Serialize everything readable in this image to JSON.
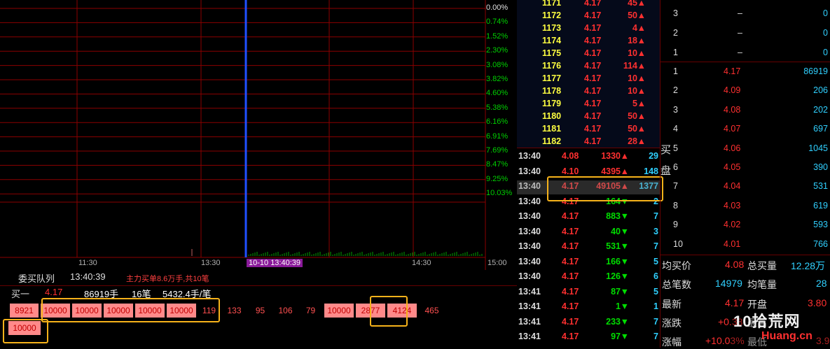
{
  "colors": {
    "up": "#ff3030",
    "down": "#00dd00",
    "grid": "#8b0000",
    "cyan": "#30d0ff",
    "highlight": "#f6b21a"
  },
  "chart": {
    "time_labels": [
      "11:30",
      "13:30",
      "15:00"
    ],
    "cursor_label": "10-10 13:40:39",
    "pct_labels": [
      "0.00%",
      "0.74%",
      "1.52%",
      "2.30%",
      "3.08%",
      "3.82%",
      "4.60%",
      "5.38%",
      "6.16%",
      "6.91%",
      "7.69%",
      "8.47%",
      "9.25%",
      "10.03%"
    ],
    "extra_time": "14:30"
  },
  "queue": {
    "title": "委买队列",
    "time": "13:40:39",
    "summary": "主力买单8.6万手,共10笔",
    "buy1_label": "买一",
    "buy1_price": "4.17",
    "buy1_volume": "86919手",
    "buy1_count": "16笔",
    "buy1_avg": "5432.4手/笔",
    "row1": [
      "8921",
      "10000",
      "10000",
      "10000",
      "10000",
      "10000",
      "119",
      "133",
      "95",
      "106",
      "79",
      "10000",
      "2877",
      "4124",
      "465"
    ],
    "row2": [
      "10000"
    ]
  },
  "ticks_top": [
    {
      "id": "1171",
      "price": "4.17",
      "vol": "45"
    },
    {
      "id": "1172",
      "price": "4.17",
      "vol": "50"
    },
    {
      "id": "1173",
      "price": "4.17",
      "vol": "4"
    },
    {
      "id": "1174",
      "price": "4.17",
      "vol": "18"
    },
    {
      "id": "1175",
      "price": "4.17",
      "vol": "10"
    },
    {
      "id": "1176",
      "price": "4.17",
      "vol": "114"
    },
    {
      "id": "1177",
      "price": "4.17",
      "vol": "10"
    },
    {
      "id": "1178",
      "price": "4.17",
      "vol": "10"
    },
    {
      "id": "1179",
      "price": "4.17",
      "vol": "5"
    },
    {
      "id": "1180",
      "price": "4.17",
      "vol": "50"
    },
    {
      "id": "1181",
      "price": "4.17",
      "vol": "50"
    },
    {
      "id": "1182",
      "price": "4.17",
      "vol": "28"
    }
  ],
  "ticks": [
    {
      "time": "13:40",
      "price": "4.08",
      "vol": "1330",
      "dir": "up",
      "n": "29"
    },
    {
      "time": "13:40",
      "price": "4.10",
      "vol": "4395",
      "dir": "up",
      "n": "148"
    },
    {
      "time": "13:40",
      "price": "4.17",
      "vol": "49105",
      "dir": "up",
      "n": "1377"
    },
    {
      "time": "13:40",
      "price": "4.17",
      "vol": "164",
      "dir": "dn",
      "n": "2"
    },
    {
      "time": "13:40",
      "price": "4.17",
      "vol": "883",
      "dir": "dn",
      "n": "7"
    },
    {
      "time": "13:40",
      "price": "4.17",
      "vol": "40",
      "dir": "dn",
      "n": "3"
    },
    {
      "time": "13:40",
      "price": "4.17",
      "vol": "531",
      "dir": "dn",
      "n": "7"
    },
    {
      "time": "13:40",
      "price": "4.17",
      "vol": "166",
      "dir": "dn",
      "n": "5"
    },
    {
      "time": "13:40",
      "price": "4.17",
      "vol": "126",
      "dir": "dn",
      "n": "6"
    },
    {
      "time": "13:41",
      "price": "4.17",
      "vol": "87",
      "dir": "dn",
      "n": "5"
    },
    {
      "time": "13:41",
      "price": "4.17",
      "vol": "1",
      "dir": "dn",
      "n": "1"
    },
    {
      "time": "13:41",
      "price": "4.17",
      "vol": "233",
      "dir": "dn",
      "n": "7"
    },
    {
      "time": "13:41",
      "price": "4.17",
      "vol": "97",
      "dir": "dn",
      "n": "7"
    }
  ],
  "side_labels": [
    "买",
    "盘"
  ],
  "asks": [
    {
      "level": "3",
      "price": "–",
      "vol": "0"
    },
    {
      "level": "2",
      "price": "–",
      "vol": "0"
    },
    {
      "level": "1",
      "price": "–",
      "vol": "0"
    }
  ],
  "bids": [
    {
      "level": "1",
      "price": "4.17",
      "vol": "86919"
    },
    {
      "level": "2",
      "price": "4.09",
      "vol": "206"
    },
    {
      "level": "3",
      "price": "4.08",
      "vol": "202"
    },
    {
      "level": "4",
      "price": "4.07",
      "vol": "697"
    },
    {
      "level": "5",
      "price": "4.06",
      "vol": "1045"
    },
    {
      "level": "6",
      "price": "4.05",
      "vol": "390"
    },
    {
      "level": "7",
      "price": "4.04",
      "vol": "531"
    },
    {
      "level": "8",
      "price": "4.03",
      "vol": "619"
    },
    {
      "level": "9",
      "price": "4.02",
      "vol": "593"
    },
    {
      "level": "10",
      "price": "4.01",
      "vol": "766"
    }
  ],
  "stats": {
    "avg_buy_label": "均买价",
    "avg_buy": "4.08",
    "total_buy_label": "总买量",
    "total_buy": "12.28万",
    "total_trades_label": "总笔数",
    "total_trades": "14979",
    "avg_vol_label": "均笔量",
    "avg_vol": "28",
    "last_label": "最新",
    "last": "4.17",
    "open_label": "开盘",
    "open": "3.80",
    "change_label": "涨跌",
    "change": "+0.38",
    "high_label": "最高",
    "pct_label": "涨幅",
    "pct": "+10.03%",
    "low_label": "最低",
    "low": "3.9"
  },
  "watermark": {
    "top": "10拾荒网",
    "bottom": "Huang.cn"
  }
}
